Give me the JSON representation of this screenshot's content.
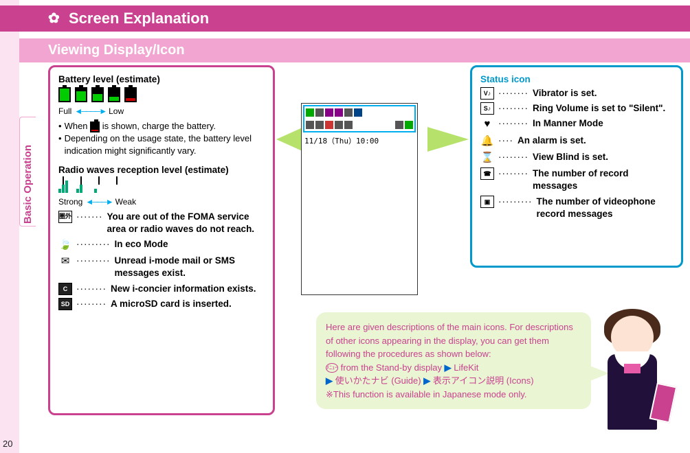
{
  "chapter_tab": "Basic Operation",
  "page_number": "20",
  "header_title": "Screen Explanation",
  "subheader_title": "Viewing Display/Icon",
  "left_panel": {
    "battery_heading": "Battery level (estimate)",
    "full_label": "Full",
    "low_label": "Low",
    "bullet1_pre": "When",
    "bullet1_post": "is shown, charge the battery.",
    "bullet2": "Depending on the usage state, the battery level indication might significantly vary.",
    "radio_heading": "Radio waves reception level (estimate)",
    "strong_label": "Strong",
    "weak_label": "Weak",
    "items": [
      {
        "text": "You are out of the FOMA service area or radio waves do not reach."
      },
      {
        "text": "In eco Mode"
      },
      {
        "text": "Unread i-mode mail or SMS messages exist."
      },
      {
        "text": "New i-concier information exists."
      },
      {
        "text": "A microSD card is inserted."
      }
    ]
  },
  "right_panel": {
    "heading": "Status icon",
    "items": [
      {
        "text": "Vibrator is set."
      },
      {
        "text": "Ring Volume is set to \"Silent\"."
      },
      {
        "text": "In Manner Mode"
      },
      {
        "text": "An alarm is set."
      },
      {
        "text": "View Blind is set."
      },
      {
        "text": "The number of record messages"
      },
      {
        "text": "The number of videophone record messages"
      }
    ]
  },
  "phone_date": "11/18（Thu）10:00",
  "speech": {
    "intro": "Here are given descriptions of the main icons. For descriptions of other icons appearing in the display, you can get them following the procedures as shown below:",
    "menu_label": "ﾒﾆｭｰ",
    "step1": "from the Stand-by display",
    "step2": "LifeKit",
    "step3": "使いかたナビ (Guide)",
    "step4": "表示アイコン説明 (Icons)",
    "note_prefix": "※",
    "note": "This function is available in Japanese mode only."
  }
}
